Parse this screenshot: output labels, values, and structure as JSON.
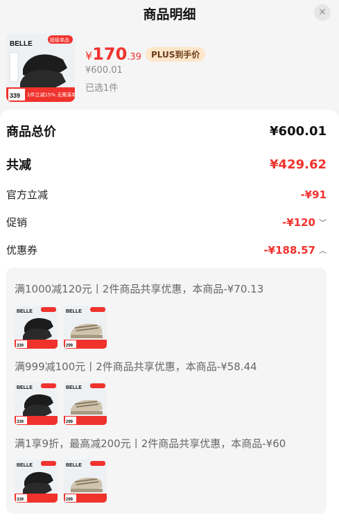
{
  "header": {
    "title": "商品明细",
    "close_icon": "close-icon"
  },
  "product": {
    "brand": "BELLE",
    "price_currency": "¥",
    "price_integer": "170",
    "price_decimal": ".39",
    "plus_badge": "PLUS到手价",
    "original_price": "¥600.01",
    "selected_count": "已选1件",
    "thumb_badge_top": "超级单品",
    "thumb_banner": "1件立减15% 无需凑单",
    "thumb_price": "339"
  },
  "summary": {
    "total_label": "商品总价",
    "total_value": "¥600.01",
    "discount_label": "共减",
    "discount_value": "¥429.62",
    "official_label": "官方立减",
    "official_value": "-¥91",
    "promo_label": "促销",
    "promo_value": "-¥120",
    "coupon_label": "优惠券",
    "coupon_value": "-¥188.57"
  },
  "coupons": [
    {
      "text": "满1000减120元丨2件商品共享优惠，本商品-¥70.13"
    },
    {
      "text": "满999减100元丨2件商品共享优惠，本商品-¥58.44"
    },
    {
      "text": "满1享9折，最高减200元丨2件商品共享优惠，本商品-¥60"
    }
  ],
  "mini_thumbs": {
    "shoe1_brand": "BELLE",
    "shoe1_price": "339",
    "shoe2_brand": "BELLE",
    "shoe2_price": "299"
  },
  "colors": {
    "accent_red": "#f0322d",
    "plus_badge_bg": "#fde6c9"
  }
}
